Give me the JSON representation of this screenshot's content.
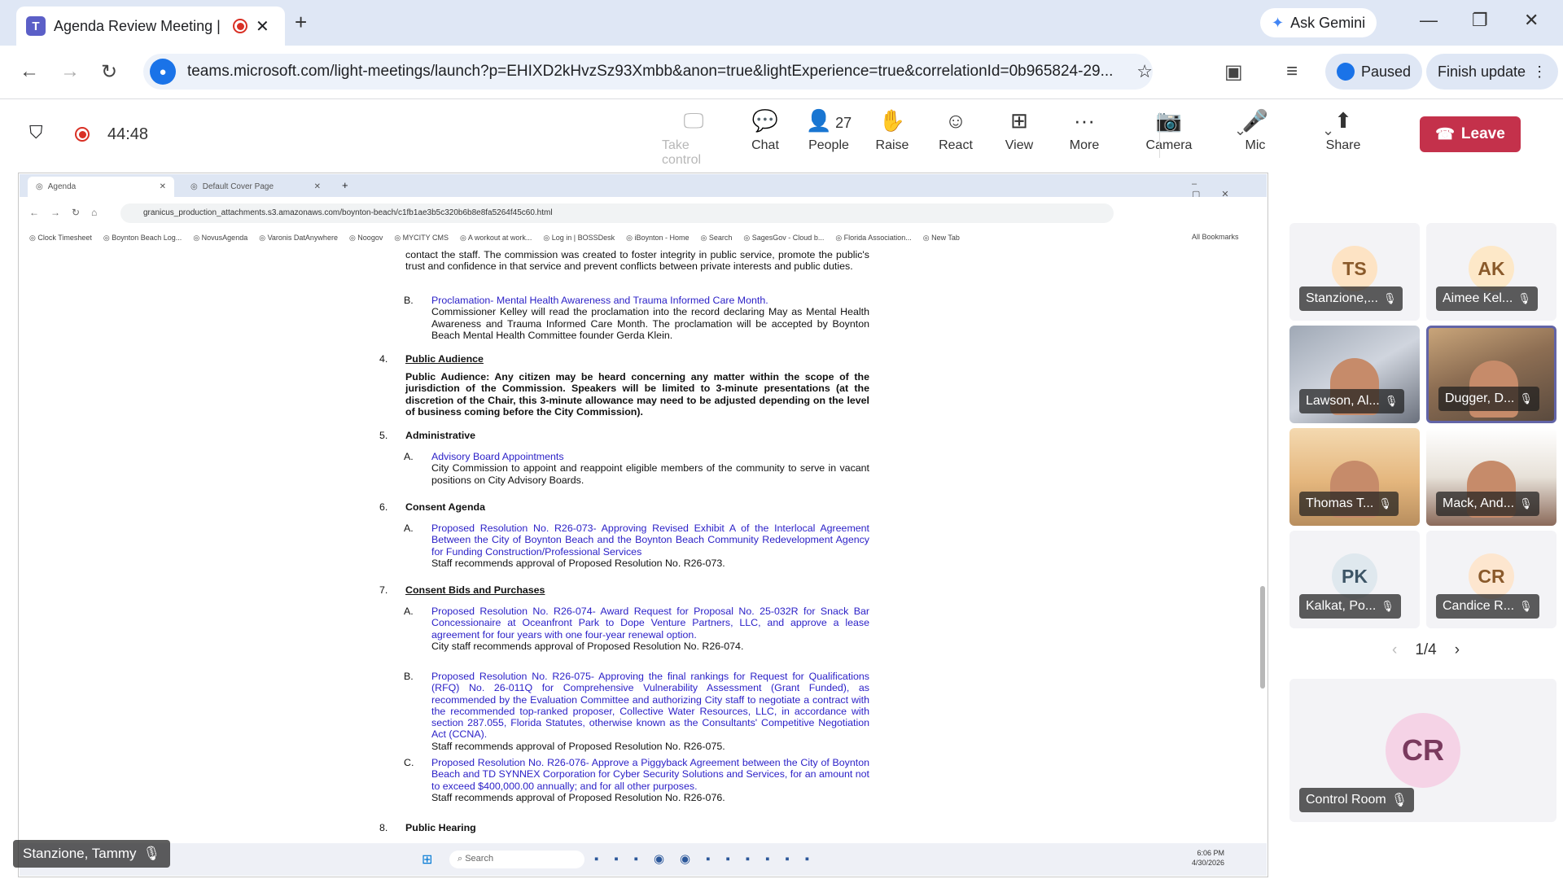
{
  "browser": {
    "tab_title": "Agenda Review Meeting | M",
    "ask_gemini": "Ask Gemini",
    "url": "teams.microsoft.com/light-meetings/launch?p=EHIXD2kHvzSz93Xmbb&anon=true&lightExperience=true&correlationId=0b965824-29...",
    "paused_label": "Paused",
    "finish_update_label": "Finish update"
  },
  "meeting": {
    "timer": "44:48",
    "toolbar": [
      {
        "label": "Take control",
        "icon": "take-control-icon",
        "glyph": "🖵",
        "disabled": true
      },
      {
        "label": "Chat",
        "icon": "chat-icon",
        "glyph": "💬",
        "disabled": false
      },
      {
        "label": "People",
        "icon": "people-icon",
        "glyph": "👤",
        "count": "27",
        "disabled": false
      },
      {
        "label": "Raise",
        "icon": "raise-hand-icon",
        "glyph": "✋",
        "disabled": false
      },
      {
        "label": "React",
        "icon": "react-icon",
        "glyph": "☺",
        "disabled": false
      },
      {
        "label": "View",
        "icon": "view-icon",
        "glyph": "⊞",
        "disabled": false
      },
      {
        "label": "More",
        "icon": "more-icon",
        "glyph": "···",
        "disabled": false
      },
      {
        "label": "Camera",
        "icon": "camera-off-icon",
        "glyph": "📷",
        "disabled": false
      },
      {
        "label": "Mic",
        "icon": "mic-icon",
        "glyph": "🎤",
        "disabled": false
      },
      {
        "label": "Share",
        "icon": "share-icon",
        "glyph": "⬆",
        "disabled": false
      }
    ],
    "leave_label": "Leave",
    "leave_color": "#c4314b"
  },
  "shared_screen": {
    "tabs": [
      "Agenda",
      "Default Cover Page"
    ],
    "url": "granicus_production_attachments.s3.amazonaws.com/boynton-beach/c1fb1ae3b5c320b6b8e8fa5264f45c60.html",
    "bookmarks": [
      "Clock Timesheet",
      "Boynton Beach Log...",
      "NovusAgenda",
      "Varonis DatAnywhere",
      "Noogov",
      "MYCITY CMS",
      "A workout at work...",
      "Log in | BOSSDesk",
      "iBoynton - Home",
      "Search",
      "SagesGov - Cloud b...",
      "Florida Association...",
      "New Tab"
    ],
    "all_bookmarks": "All Bookmarks",
    "document": {
      "intro_tail": "contact the staff. The commission was created to foster integrity in public service, promote the public's trust and confidence in that service and prevent conflicts between private interests and public duties.",
      "item_b_letter": "B.",
      "item_b_title": "Proclamation- Mental Health Awareness and Trauma Informed Care Month.",
      "item_b_body": "Commissioner Kelley will read the proclamation into the record declaring May as Mental Health Awareness and Trauma Informed Care Month. The proclamation will be accepted by Boynton Beach Mental Health Committee founder Gerda Klein.",
      "s4_num": "4.",
      "s4_title": "Public Audience",
      "s4_body": "Public Audience: Any citizen may be heard concerning any matter within the scope of the jurisdiction of the Commission. Speakers will be limited to 3-minute presentations (at the discretion of the Chair, this 3-minute allowance may need to be adjusted depending on the level of business coming before the City Commission).",
      "s5_num": "5.",
      "s5_title": "Administrative",
      "s5a_letter": "A.",
      "s5a_title": "Advisory Board Appointments",
      "s5a_body": "City Commission to appoint and reappoint eligible members of the community to serve in vacant positions on City Advisory Boards.",
      "s6_num": "6.",
      "s6_title": "Consent Agenda",
      "s6a_letter": "A.",
      "s6a_title": "Proposed Resolution No. R26-073- Approving Revised Exhibit A of the Interlocal Agreement Between the City of Boynton Beach and the Boynton Beach Community Redevelopment Agency for Funding Construction/Professional Services",
      "s6a_body": "Staff recommends approval of Proposed Resolution No. R26-073.",
      "s7_num": "7.",
      "s7_title": "Consent Bids and Purchases",
      "s7a_letter": "A.",
      "s7a_title": "Proposed Resolution No. R26-074- Award Request for Proposal No. 25-032R for Snack Bar Concessionaire at Oceanfront Park to Dope Venture Partners, LLC, and approve a lease agreement for four years with one four-year renewal option.",
      "s7a_body": "City staff recommends approval of Proposed Resolution No. R26-074.",
      "s7b_letter": "B.",
      "s7b_title": "Proposed Resolution No. R26-075- Approving the final rankings for Request for Qualifications (RFQ) No. 26-011Q for Comprehensive Vulnerability Assessment (Grant Funded), as recommended by the Evaluation Committee and authorizing City staff to negotiate a contract with the recommended top-ranked proposer, Collective Water Resources, LLC, in accordance with section 287.055, Florida Statutes, otherwise known as the Consultants' Competitive Negotiation Act (CCNA).",
      "s7b_body": "Staff recommends approval of Proposed Resolution No. R26-075.",
      "s7c_letter": "C.",
      "s7c_title": "Proposed Resolution No. R26-076- Approve a Piggyback Agreement between the City of Boynton Beach and TD SYNNEX Corporation for Cyber Security Solutions and Services, for an amount not to exceed $400,000.00 annually; and for all other purposes.",
      "s7c_body": "Staff recommends approval of Proposed Resolution No. R26-076.",
      "s8_num": "8.",
      "s8_title": "Public Hearing"
    },
    "taskbar_search": "Search",
    "clock_time": "6:06 PM",
    "clock_date": "4/30/2026"
  },
  "speaker_label": "Stanzione, Tammy",
  "participants": [
    {
      "initials": "TS",
      "name": "Stanzione,...",
      "avatar_color": "#fde3c4",
      "text_color": "#8a5a2b",
      "video": false
    },
    {
      "initials": "AK",
      "name": "Aimee Kel...",
      "avatar_color": "#fde8c8",
      "text_color": "#8a5a2b",
      "video": false
    },
    {
      "initials": "",
      "name": "Lawson, Al...",
      "video": true
    },
    {
      "initials": "",
      "name": "Dugger, D...",
      "video": true
    },
    {
      "initials": "",
      "name": "Thomas T...",
      "video": true
    },
    {
      "initials": "",
      "name": "Mack, And...",
      "video": true
    },
    {
      "initials": "PK",
      "name": "Kalkat, Po...",
      "avatar_color": "#dfe8ee",
      "text_color": "#3d5566",
      "video": false
    },
    {
      "initials": "CR",
      "name": "Candice R...",
      "avatar_color": "#fde6cf",
      "text_color": "#8a5a2b",
      "video": false
    }
  ],
  "pager": "1/4",
  "featured": {
    "initials": "CR",
    "name": "Control Room",
    "avatar_color": "#f5d3e6",
    "text_color": "#7a3a5e"
  }
}
